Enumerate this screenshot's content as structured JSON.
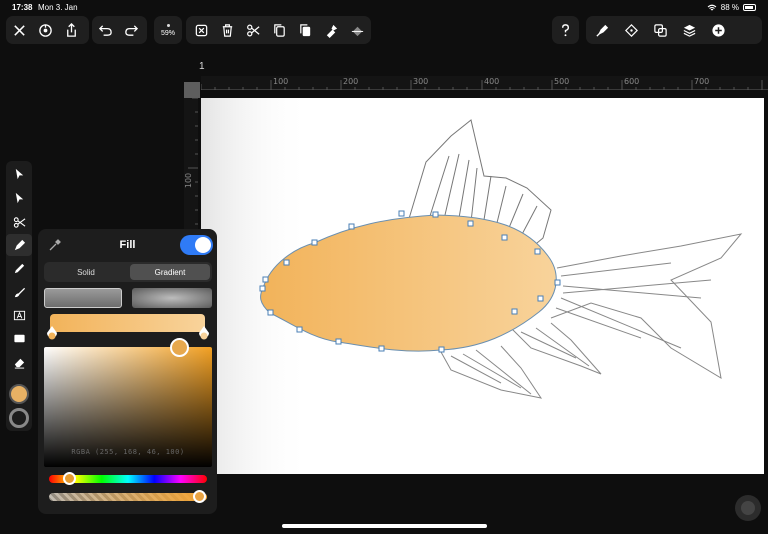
{
  "status_bar": {
    "time": "17:38",
    "date": "Mon 3. Jan",
    "battery": "88 %"
  },
  "toolbar": {
    "left": [
      "close-icon",
      "settings-icon",
      "share-icon"
    ],
    "history": [
      "undo-icon",
      "redo-icon"
    ],
    "zoom": "59%",
    "edit": [
      "select-box-icon",
      "trash-icon",
      "scissors-icon",
      "copy-icon",
      "paste-icon",
      "style-paste-icon",
      "fill-icon"
    ],
    "right": [
      "help-icon",
      "pen-tool-icon",
      "transform-icon",
      "boolean-icon",
      "layers-icon",
      "add-icon"
    ]
  },
  "ruler": {
    "page_number": "1",
    "top_labels": [
      "100",
      "200",
      "300",
      "400",
      "500",
      "600",
      "700"
    ],
    "left_labels": [
      "100"
    ]
  },
  "tools": [
    "select-icon",
    "direct-select-icon",
    "scissors-tool-icon",
    "pen-icon",
    "pencil-icon",
    "brush-icon",
    "text-icon",
    "rectangle-icon",
    "eraser-icon"
  ],
  "fill_panel": {
    "title": "Fill",
    "enabled": true,
    "modes": [
      "Solid",
      "Gradient"
    ],
    "selected_mode": "Gradient",
    "rgba_readout": "RGBA (255, 168, 46, 100)",
    "hue_position": 0.1,
    "alpha_position": 1.0
  },
  "colors": {
    "fill": "#e7b164",
    "gradient_start": "#f2b35a",
    "gradient_end": "#f8d39b",
    "accent": "#2f7bf6"
  }
}
